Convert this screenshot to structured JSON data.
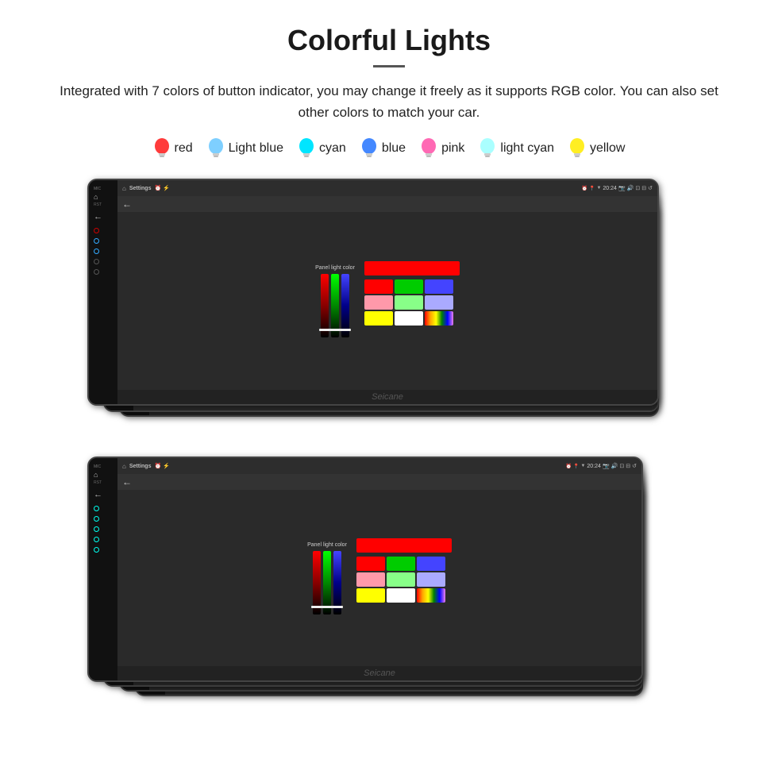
{
  "page": {
    "title": "Colorful Lights",
    "subtitle": "Integrated with 7 colors of button indicator, you may change it freely as it supports RGB color. You can also set other colors to match your car.",
    "watermark": "Seicane"
  },
  "colors": [
    {
      "name": "red",
      "color": "#ff3b3b",
      "bulb_unicode": "💡"
    },
    {
      "name": "Light blue",
      "color": "#7ecfff",
      "bulb_unicode": "💡"
    },
    {
      "name": "cyan",
      "color": "#00e5ff",
      "bulb_unicode": "💡"
    },
    {
      "name": "blue",
      "color": "#4488ff",
      "bulb_unicode": "💡"
    },
    {
      "name": "pink",
      "color": "#ff69b4",
      "bulb_unicode": "💡"
    },
    {
      "name": "light cyan",
      "color": "#aaffff",
      "bulb_unicode": "💡"
    },
    {
      "name": "yellow",
      "color": "#ffee22",
      "bulb_unicode": "💡"
    }
  ],
  "device": {
    "settings_label": "Settings",
    "back_label": "←",
    "panel_light_label": "Panel light color",
    "time": "20:24"
  }
}
